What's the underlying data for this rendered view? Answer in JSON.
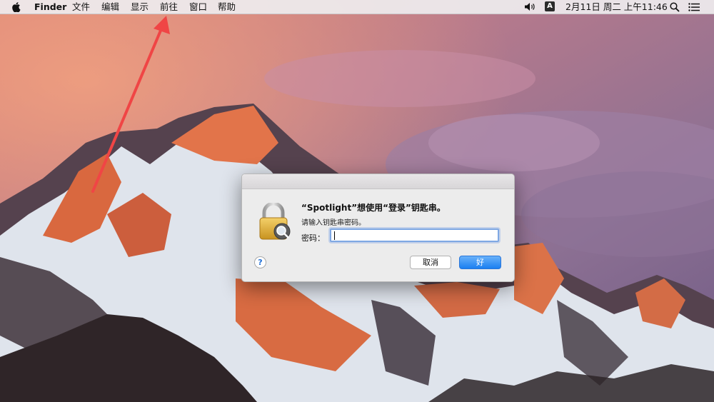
{
  "menubar": {
    "app_name": "Finder",
    "menus": [
      "文件",
      "编辑",
      "显示",
      "前往",
      "窗口",
      "帮助"
    ],
    "ime_label": "A",
    "clock": "2月11日 周二 上午11:46"
  },
  "dialog": {
    "title": "“Spotlight”想使用“登录”钥匙串。",
    "subtitle": "请输入钥匙串密码。",
    "password_label": "密码：",
    "password_value": "",
    "help_label": "?",
    "cancel_label": "取消",
    "ok_label": "好"
  },
  "colors": {
    "annotation_arrow": "#f04545",
    "ok_button": "#1a7ff1"
  },
  "icons": [
    "apple-logo-icon",
    "volume-icon",
    "search-icon",
    "notification-list-icon",
    "keychain-lock-icon",
    "magnifier-icon"
  ]
}
